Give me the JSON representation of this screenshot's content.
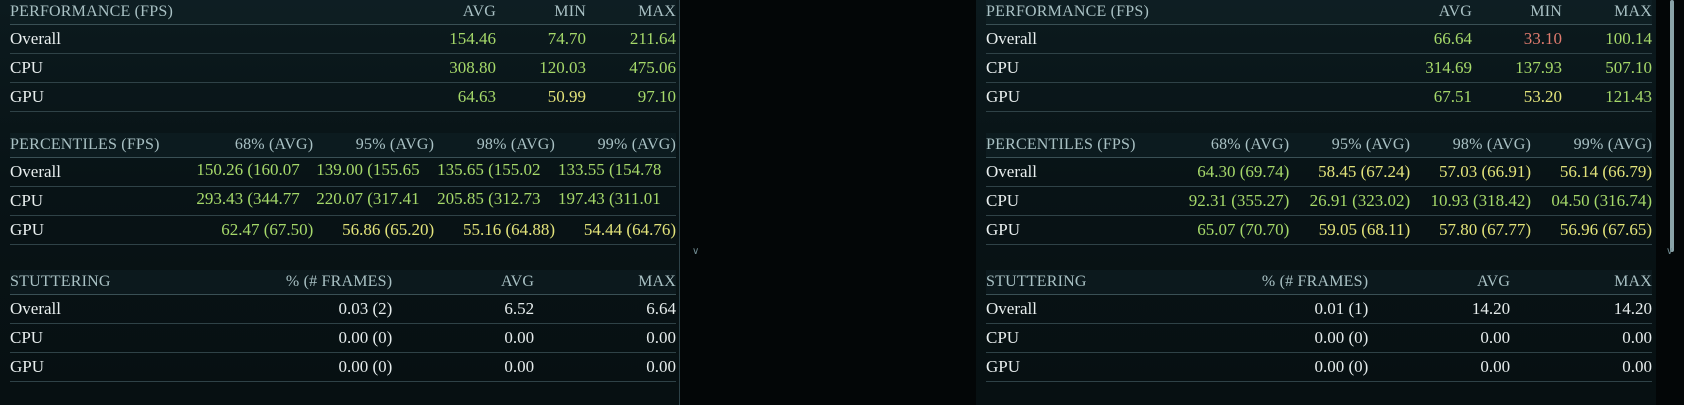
{
  "panels": [
    {
      "performance": {
        "header": [
          "PERFORMANCE (FPS)",
          "AVG",
          "MIN",
          "MAX"
        ],
        "rows": [
          {
            "label": "Overall",
            "avg": "154.46",
            "min": "74.70",
            "max": "211.64"
          },
          {
            "label": "CPU",
            "avg": "308.80",
            "min": "120.03",
            "max": "475.06"
          },
          {
            "label": "GPU",
            "avg": "64.63",
            "min": "50.99",
            "max": "97.10"
          }
        ]
      },
      "percentiles": {
        "header": [
          "PERCENTILES (FPS)",
          "68% (AVG)",
          "95% (AVG)",
          "98% (AVG)",
          "99% (AVG)"
        ],
        "rows": [
          {
            "label": "Overall",
            "p68": "150.26 (160.07",
            "p95": "139.00 (155.65",
            "p98": "135.65 (155.02",
            "p99": "133.55 (154.78"
          },
          {
            "label": "CPU",
            "p68": "293.43 (344.77",
            "p95": "220.07 (317.41",
            "p98": "205.85 (312.73",
            "p99": "197.43 (311.01"
          },
          {
            "label": "GPU",
            "p68": "62.47 (67.50)",
            "p95": "56.86 (65.20)",
            "p98": "55.16 (64.88)",
            "p99": "54.44 (64.76)"
          }
        ]
      },
      "stuttering": {
        "header": [
          "STUTTERING",
          "% (# FRAMES)",
          "AVG",
          "MAX"
        ],
        "rows": [
          {
            "label": "Overall",
            "pct": "0.03 (2)",
            "avg": "6.52",
            "max": "6.64"
          },
          {
            "label": "CPU",
            "pct": "0.00 (0)",
            "avg": "0.00",
            "max": "0.00"
          },
          {
            "label": "GPU",
            "pct": "0.00 (0)",
            "avg": "0.00",
            "max": "0.00"
          }
        ]
      }
    },
    {
      "performance": {
        "header": [
          "PERFORMANCE (FPS)",
          "AVG",
          "MIN",
          "MAX"
        ],
        "rows": [
          {
            "label": "Overall",
            "avg": "66.64",
            "min": "33.10",
            "max": "100.14"
          },
          {
            "label": "CPU",
            "avg": "314.69",
            "min": "137.93",
            "max": "507.10"
          },
          {
            "label": "GPU",
            "avg": "67.51",
            "min": "53.20",
            "max": "121.43"
          }
        ]
      },
      "percentiles": {
        "header": [
          "PERCENTILES (FPS)",
          "68% (AVG)",
          "95% (AVG)",
          "98% (AVG)",
          "99% (AVG)"
        ],
        "rows": [
          {
            "label": "Overall",
            "p68": "64.30 (69.74)",
            "p95": "58.45 (67.24)",
            "p98": "57.03 (66.91)",
            "p99": "56.14 (66.79)"
          },
          {
            "label": "CPU",
            "p68": "92.31 (355.27)",
            "p95": "26.91 (323.02)",
            "p98": "10.93 (318.42)",
            "p99": "04.50 (316.74)"
          },
          {
            "label": "GPU",
            "p68": "65.07 (70.70)",
            "p95": "59.05 (68.11)",
            "p98": "57.80 (67.77)",
            "p99": "56.96 (67.65)"
          }
        ]
      },
      "stuttering": {
        "header": [
          "STUTTERING",
          "% (# FRAMES)",
          "AVG",
          "MAX"
        ],
        "rows": [
          {
            "label": "Overall",
            "pct": "0.01 (1)",
            "avg": "14.20",
            "max": "14.20"
          },
          {
            "label": "CPU",
            "pct": "0.00 (0)",
            "avg": "0.00",
            "max": "0.00"
          },
          {
            "label": "GPU",
            "pct": "0.00 (0)",
            "avg": "0.00",
            "max": "0.00"
          }
        ]
      }
    }
  ],
  "colors": {
    "good": "#a6d96a",
    "warn": "#e3e37a",
    "bad": "#e07b6e",
    "neutral": "#e6ecec",
    "header": "#a9c1c4"
  },
  "icons": {
    "scroll_up": "chevron-up-icon",
    "scroll_down": "chevron-down-icon"
  }
}
